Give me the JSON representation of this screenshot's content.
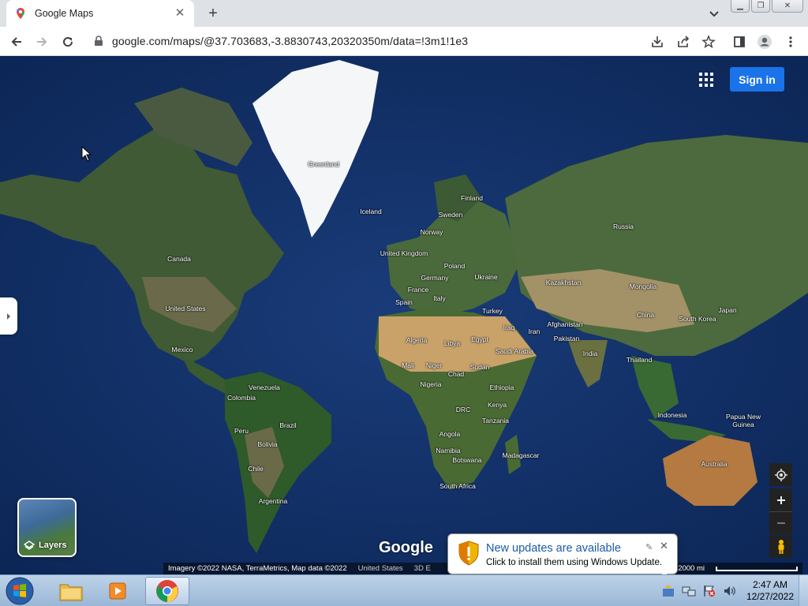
{
  "browser": {
    "tab_title": "Google Maps",
    "url": "google.com/maps/@37.703683,-3.8830743,20320350m/data=!3m1!1e3"
  },
  "map": {
    "signin_label": "Sign in",
    "layers_label": "Layers",
    "google_logo": "Google",
    "attribution": {
      "imagery": "Imagery ©2022 NASA, TerraMetrics, Map data ©2022",
      "region": "United States",
      "scale_partial": "3D E",
      "scale": "2000 mi"
    },
    "labels": {
      "greenland": "Greenland",
      "iceland": "Iceland",
      "finland": "Finland",
      "sweden": "Sweden",
      "norway": "Norway",
      "uk": "United Kingdom",
      "poland": "Poland",
      "germany": "Germany",
      "ukraine": "Ukraine",
      "france": "France",
      "spain": "Spain",
      "italy": "Italy",
      "turkey": "Turkey",
      "russia": "Russia",
      "kazakhstan": "Kazakhstan",
      "mongolia": "Mongolia",
      "china": "China",
      "south_korea": "South Korea",
      "japan": "Japan",
      "iraq": "Iraq",
      "iran": "Iran",
      "afghanistan": "Afghanistan",
      "pakistan": "Pakistan",
      "india": "India",
      "thailand": "Thailand",
      "indonesia": "Indonesia",
      "png": "Papua New Guinea",
      "australia": "Australia",
      "algeria": "Algeria",
      "libya": "Libya",
      "egypt": "Egypt",
      "saudi": "Saudi Arabia",
      "mali": "Mali",
      "niger": "Niger",
      "chad": "Chad",
      "sudan": "Sudan",
      "nigeria": "Nigeria",
      "ethiopia": "Ethiopia",
      "drc": "DRC",
      "kenya": "Kenya",
      "tanzania": "Tanzania",
      "angola": "Angola",
      "namibia": "Namibia",
      "botswana": "Botswana",
      "madagascar": "Madagascar",
      "south_africa": "South Africa",
      "canada": "Canada",
      "usa": "United States",
      "mexico": "Mexico",
      "venezuela": "Venezuela",
      "colombia": "Colombia",
      "peru": "Peru",
      "brazil": "Brazil",
      "bolivia": "Bolivia",
      "chile": "Chile",
      "argentina": "Argentina"
    }
  },
  "notification": {
    "title": "New updates are available",
    "body": "Click to install them using Windows Update."
  },
  "taskbar": {
    "time": "2:47 AM",
    "date": "12/27/2022"
  },
  "colors": {
    "signin_bg": "#1a73e8",
    "ocean": "#102f66",
    "notif_title": "#1e5aa8"
  }
}
